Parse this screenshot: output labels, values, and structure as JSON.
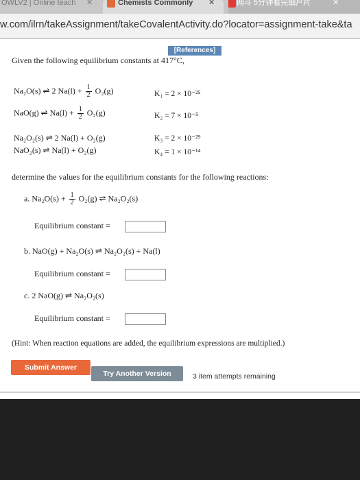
{
  "browser": {
    "tabs": [
      {
        "label": "OWLV2 | Online teach"
      },
      {
        "label": "Chemists Commonly"
      },
      {
        "label": "网斗 5分钟看完细户片"
      }
    ],
    "tab_close": "✕",
    "url": "w.com/ilrn/takeAssignment/takeCovalentActivity.do?locator=assignment-take&ta"
  },
  "question": {
    "references_label": "[References]",
    "intro": "Given the following equilibrium constants at 417°C,",
    "reactions": [
      {
        "lhs": "Na₂O(s) ⇌ 2 Na(l) +",
        "frac_num": "1",
        "frac_den": "2",
        "rhs": "O₂(g)",
        "k": "K₁ = 2 × 10⁻²⁵"
      },
      {
        "lhs": "NaO(g) ⇌ Na(l) +",
        "frac_num": "1",
        "frac_den": "2",
        "rhs": "O₂(g)",
        "k": "K₂ = 7 × 10⁻⁵"
      },
      {
        "lhs": "Na₂O₂(s) ⇌ 2 Na(l) + O₂(g)",
        "k": "K₃ = 2 × 10⁻²⁹"
      },
      {
        "lhs": "NaO₂(s) ⇌ Na(l) + O₂(g)",
        "k": "K₄ = 1 × 10⁻¹⁴"
      }
    ],
    "instruction": "determine the values for the equilibrium constants for the following reactions:",
    "parts": [
      {
        "letter": "a.",
        "lhs": "Na₂O(s) +",
        "frac_num": "1",
        "frac_den": "2",
        "rhs": "O₂(g) ⇌ Na₂O₂(s)",
        "answer_label": "Equilibrium constant =",
        "answer_value": ""
      },
      {
        "letter": "b.",
        "lhs": "NaO(g) + Na₂O(s) ⇌ Na₂O₂(s) + Na(l)",
        "answer_label": "Equilibrium constant =",
        "answer_value": ""
      },
      {
        "letter": "c.",
        "lhs": "2 NaO(g) ⇌ Na₂O₂(s)",
        "answer_label": "Equilibrium constant =",
        "answer_value": ""
      }
    ],
    "hint": "(Hint: When reaction equations are added, the equilibrium expressions are multiplied.)"
  },
  "actions": {
    "submit_label": "Submit Answer",
    "try_label": "Try Another Version",
    "attempts": "3 item attempts remaining"
  },
  "colors": {
    "submit": "#e8683a",
    "try": "#7d8c96",
    "references": "#5a86b8"
  }
}
